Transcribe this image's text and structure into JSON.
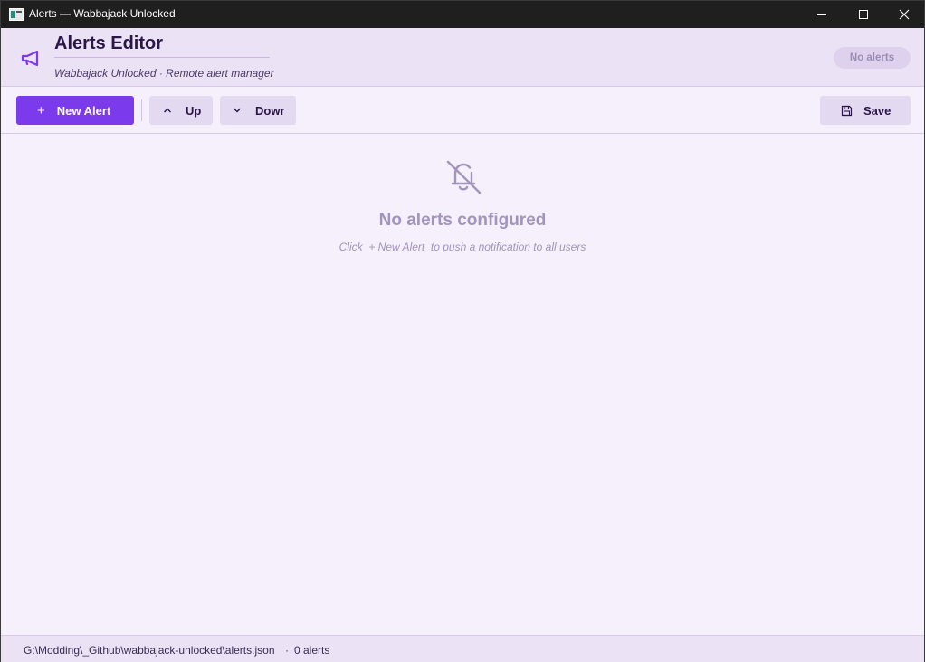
{
  "window": {
    "title": "Alerts — Wabbajack Unlocked",
    "controls": [
      "minimize-icon",
      "maximize-icon",
      "close-icon"
    ]
  },
  "header": {
    "icon": "megaphone-icon",
    "title": "Alerts Editor",
    "subtitle": "Wabbajack Unlocked · Remote alert manager",
    "badge": "No alerts"
  },
  "toolbar": {
    "new_glyph": "+",
    "new_label": "New Alert",
    "up_label": "Up",
    "down_label": "Down",
    "save_label": "Save"
  },
  "empty_state": {
    "icon": "bell-off-icon",
    "title": "No alerts configured",
    "hint": "Click  + New Alert  to push a notification to all users"
  },
  "status": {
    "path": "G:\\Modding\\_Github\\wabbajack-unlocked\\alerts.json",
    "separator": "·",
    "count": "0 alerts"
  },
  "colors": {
    "accent": "#7c3aed",
    "header_bg": "#ebe2f6",
    "body_bg": "#f5f0fb",
    "muted": "#a394bc"
  }
}
